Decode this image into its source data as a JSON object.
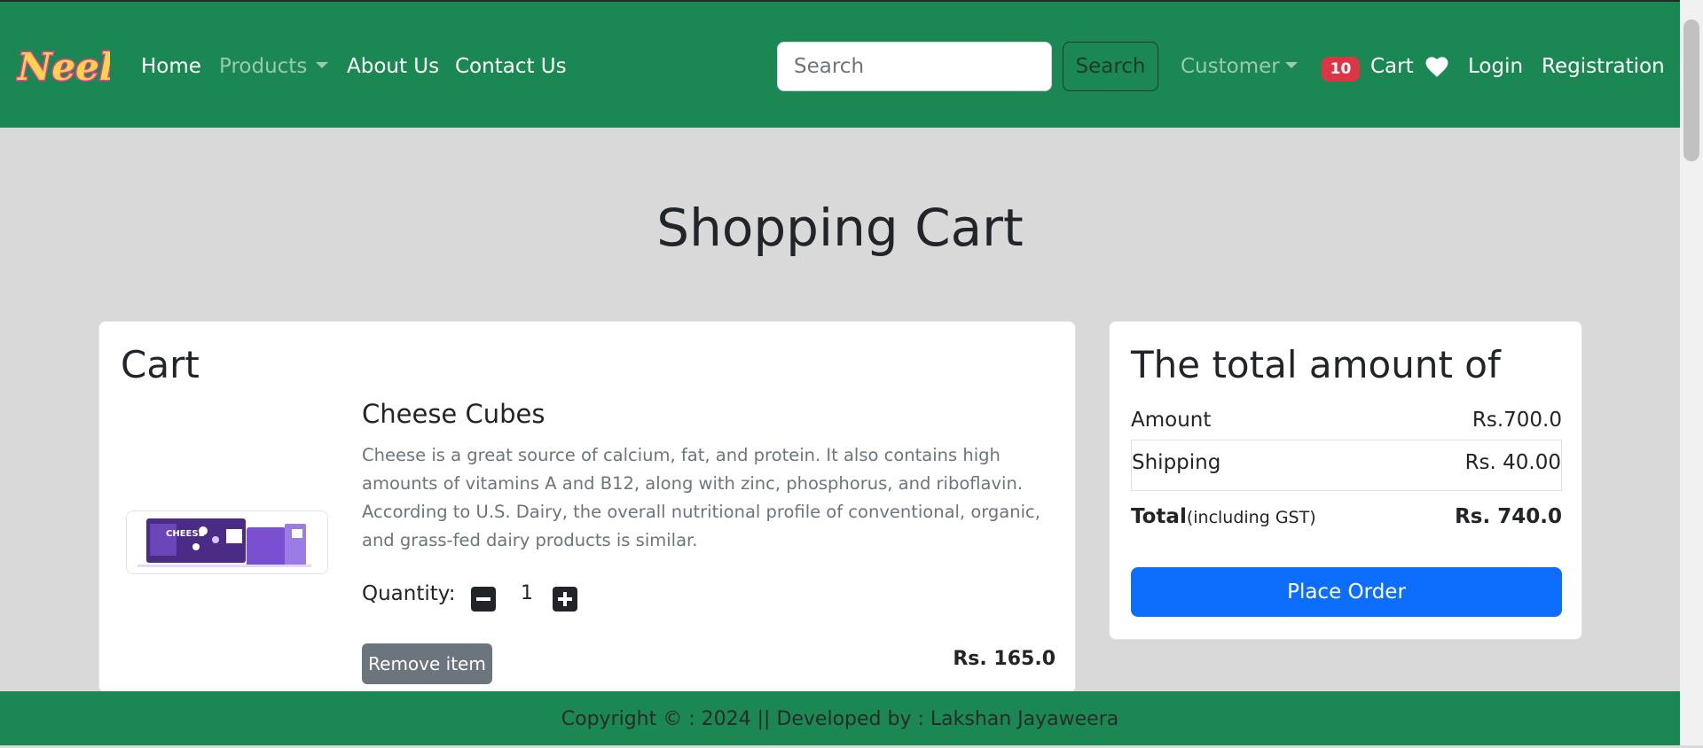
{
  "colors": {
    "navbar": "#1b8752",
    "badge": "#dc3545",
    "primary_button": "#0d6efd",
    "secondary_button": "#6c757d",
    "page_bg": "#d9d9d9"
  },
  "nav": {
    "logo_text": "Neel",
    "home": "Home",
    "products": "Products",
    "about": "About Us",
    "contact": "Contact Us",
    "search_placeholder": "Search",
    "search_button": "Search",
    "customer": "Customer",
    "cart_count": "10",
    "cart": "Cart",
    "wishlist_icon": "heart-icon",
    "login": "Login",
    "registration": "Registration"
  },
  "page_title": "Shopping Cart",
  "cart": {
    "title": "Cart",
    "items": [
      {
        "name": "Cheese Cubes",
        "description": "Cheese is a great source of calcium, fat, and protein. It also contains high amounts of vitamins A and B12, along with zinc, phosphorus, and riboflavin. According to U.S. Dairy, the overall nutritional profile of conventional, organic, and grass-fed dairy products is similar.",
        "image_text": "CHEESE",
        "quantity_label": "Quantity:",
        "quantity": "1",
        "remove_label": "Remove item",
        "price": "Rs. 165.0"
      }
    ]
  },
  "summary": {
    "title": "The total amount of",
    "amount_label": "Amount",
    "amount_value": "Rs.700.0",
    "shipping_label": "Shipping",
    "shipping_value": "Rs. 40.00",
    "total_label": "Total",
    "total_note": "(including GST)",
    "total_value": "Rs. 740.0",
    "place_order": "Place Order"
  },
  "footer": {
    "text": "Copyright © : 2024 || Developed by : Lakshan Jayaweera"
  }
}
